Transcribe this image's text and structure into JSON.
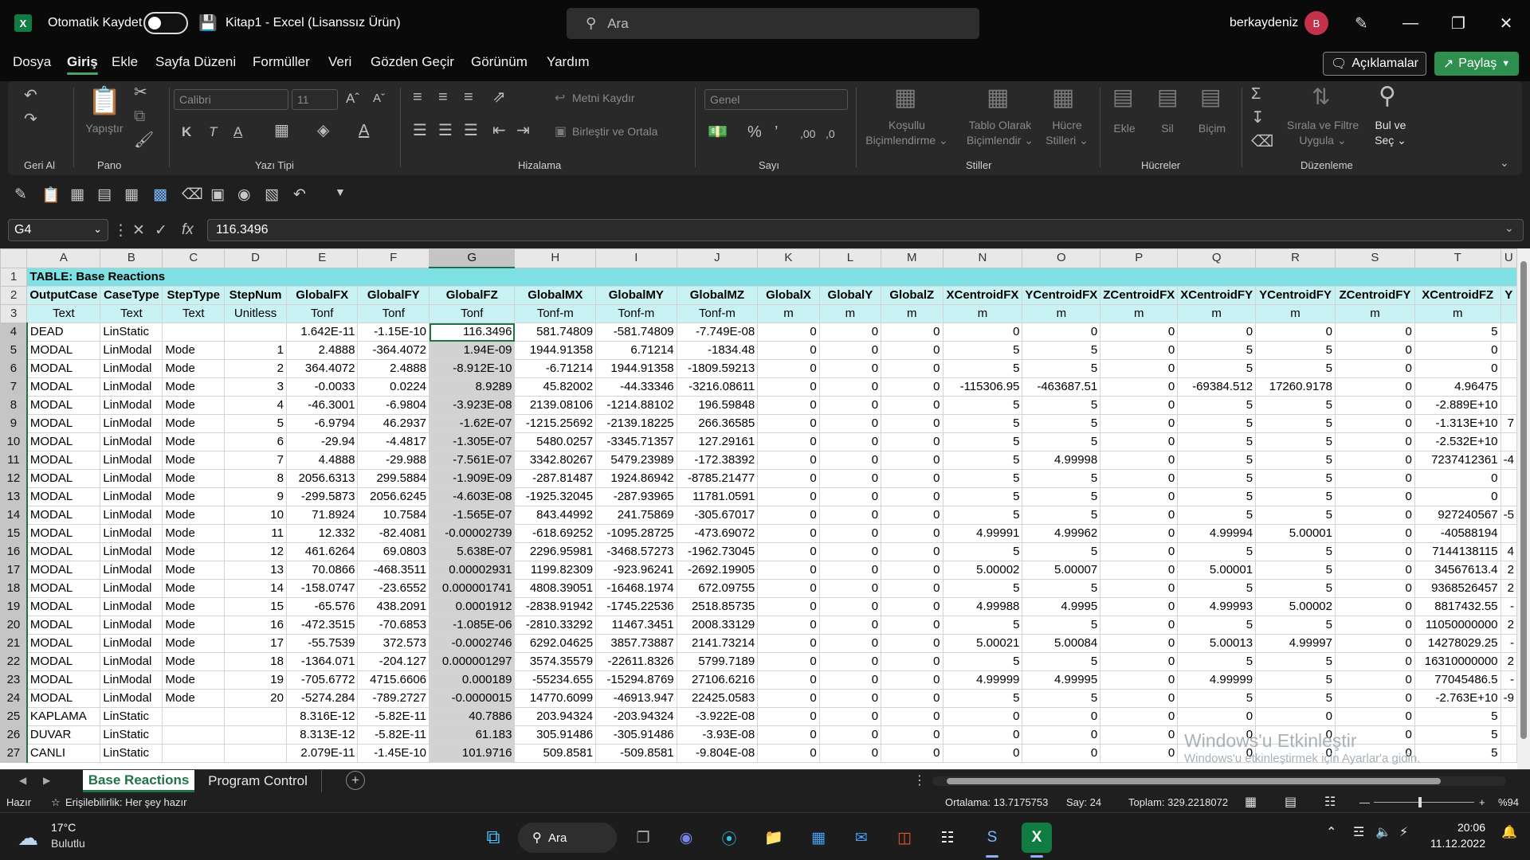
{
  "titlebar": {
    "autosave_label": "Otomatik Kaydet",
    "doc_title": "Kitap1  -  Excel (Lisanssız Ürün)",
    "search_placeholder": "Ara",
    "user_name": "berkaydeniz",
    "avatar_initial": "B"
  },
  "menu": [
    "Dosya",
    "Giriş",
    "Ekle",
    "Sayfa Düzeni",
    "Formüller",
    "Veri",
    "Gözden Geçir",
    "Görünüm",
    "Yardım"
  ],
  "comments_label": "Açıklamalar",
  "share_label": "Paylaş",
  "ribbon": {
    "groups": {
      "undo": "Geri Al",
      "clipboard": "Pano",
      "font": "Yazı Tipi",
      "alignment": "Hizalama",
      "number": "Sayı",
      "styles": "Stiller",
      "cells": "Hücreler",
      "editing": "Düzenleme"
    },
    "paste": "Yapıştır",
    "font_name": "Calibri",
    "font_size": "11",
    "wrap_text": "Metni Kaydır",
    "merge_center": "Birleştir ve Ortala",
    "number_format": "Genel",
    "cond_format": [
      "Koşullu",
      "Biçimlendirme ⌄"
    ],
    "format_table": [
      "Tablo Olarak",
      "Biçimlendir ⌄"
    ],
    "cell_styles": [
      "Hücre",
      "Stilleri ⌄"
    ],
    "insert": "Ekle",
    "delete": "Sil",
    "format": "Biçim",
    "sort_filter": [
      "Sırala ve Filtre",
      "Uygula ⌄"
    ],
    "find_select": [
      "Bul ve",
      "Seç ⌄"
    ]
  },
  "formula": {
    "name_box": "G4",
    "value": "116.3496"
  },
  "sheet": {
    "columns": [
      "A",
      "B",
      "C",
      "D",
      "E",
      "F",
      "G",
      "H",
      "I",
      "J",
      "K",
      "L",
      "M",
      "N",
      "O",
      "P",
      "Q",
      "R",
      "S",
      "T",
      "U"
    ],
    "title": "TABLE:  Base Reactions",
    "headers": [
      "OutputCase",
      "CaseType",
      "StepType",
      "StepNum",
      "GlobalFX",
      "GlobalFY",
      "GlobalFZ",
      "GlobalMX",
      "GlobalMY",
      "GlobalMZ",
      "GlobalX",
      "GlobalY",
      "GlobalZ",
      "XCentroidFX",
      "YCentroidFX",
      "ZCentroidFX",
      "XCentroidFY",
      "YCentroidFY",
      "ZCentroidFY",
      "XCentroidFZ",
      "Y"
    ],
    "units": [
      "Text",
      "Text",
      "Text",
      "Unitless",
      "Tonf",
      "Tonf",
      "Tonf",
      "Tonf-m",
      "Tonf-m",
      "Tonf-m",
      "m",
      "m",
      "m",
      "m",
      "m",
      "m",
      "m",
      "m",
      "m",
      "m",
      ""
    ],
    "rows": [
      [
        "DEAD",
        "LinStatic",
        "",
        "",
        "1.642E-11",
        "-1.15E-10",
        "116.3496",
        "581.74809",
        "-581.74809",
        "-7.749E-08",
        "0",
        "0",
        "0",
        "0",
        "0",
        "0",
        "0",
        "0",
        "0",
        "5",
        ""
      ],
      [
        "MODAL",
        "LinModal",
        "Mode",
        "1",
        "2.4888",
        "-364.4072",
        "1.94E-09",
        "1944.91358",
        "6.71214",
        "-1834.48",
        "0",
        "0",
        "0",
        "5",
        "5",
        "0",
        "5",
        "5",
        "0",
        "0",
        ""
      ],
      [
        "MODAL",
        "LinModal",
        "Mode",
        "2",
        "364.4072",
        "2.4888",
        "-8.912E-10",
        "-6.71214",
        "1944.91358",
        "-1809.59213",
        "0",
        "0",
        "0",
        "5",
        "5",
        "0",
        "5",
        "5",
        "0",
        "0",
        ""
      ],
      [
        "MODAL",
        "LinModal",
        "Mode",
        "3",
        "-0.0033",
        "0.0224",
        "8.9289",
        "45.82002",
        "-44.33346",
        "-3216.08611",
        "0",
        "0",
        "0",
        "-115306.95",
        "-463687.51",
        "0",
        "-69384.512",
        "17260.9178",
        "0",
        "4.96475",
        ""
      ],
      [
        "MODAL",
        "LinModal",
        "Mode",
        "4",
        "-46.3001",
        "-6.9804",
        "-3.923E-08",
        "2139.08106",
        "-1214.88102",
        "196.59848",
        "0",
        "0",
        "0",
        "5",
        "5",
        "0",
        "5",
        "5",
        "0",
        "-2.889E+10",
        ""
      ],
      [
        "MODAL",
        "LinModal",
        "Mode",
        "5",
        "-6.9794",
        "46.2937",
        "-1.62E-07",
        "-1215.25692",
        "-2139.18225",
        "266.36585",
        "0",
        "0",
        "0",
        "5",
        "5",
        "0",
        "5",
        "5",
        "0",
        "-1.313E+10",
        "7"
      ],
      [
        "MODAL",
        "LinModal",
        "Mode",
        "6",
        "-29.94",
        "-4.4817",
        "-1.305E-07",
        "5480.0257",
        "-3345.71357",
        "127.29161",
        "0",
        "0",
        "0",
        "5",
        "5",
        "0",
        "5",
        "5",
        "0",
        "-2.532E+10",
        ""
      ],
      [
        "MODAL",
        "LinModal",
        "Mode",
        "7",
        "4.4888",
        "-29.988",
        "-7.561E-07",
        "3342.80267",
        "5479.23989",
        "-172.38392",
        "0",
        "0",
        "0",
        "5",
        "4.99998",
        "0",
        "5",
        "5",
        "0",
        "7237412361",
        "-4"
      ],
      [
        "MODAL",
        "LinModal",
        "Mode",
        "8",
        "2056.6313",
        "299.5884",
        "-1.909E-09",
        "-287.81487",
        "1924.86942",
        "-8785.21477",
        "0",
        "0",
        "0",
        "5",
        "5",
        "0",
        "5",
        "5",
        "0",
        "0",
        ""
      ],
      [
        "MODAL",
        "LinModal",
        "Mode",
        "9",
        "-299.5873",
        "2056.6245",
        "-4.603E-08",
        "-1925.32045",
        "-287.93965",
        "11781.0591",
        "0",
        "0",
        "0",
        "5",
        "5",
        "0",
        "5",
        "5",
        "0",
        "0",
        ""
      ],
      [
        "MODAL",
        "LinModal",
        "Mode",
        "10",
        "71.8924",
        "10.7584",
        "-1.565E-07",
        "843.44992",
        "241.75869",
        "-305.67017",
        "0",
        "0",
        "0",
        "5",
        "5",
        "0",
        "5",
        "5",
        "0",
        "927240567",
        "-5"
      ],
      [
        "MODAL",
        "LinModal",
        "Mode",
        "11",
        "12.332",
        "-82.4081",
        "-0.00002739",
        "-618.69252",
        "-1095.28725",
        "-473.69072",
        "0",
        "0",
        "0",
        "4.99991",
        "4.99962",
        "0",
        "4.99994",
        "5.00001",
        "0",
        "-40588194",
        ""
      ],
      [
        "MODAL",
        "LinModal",
        "Mode",
        "12",
        "461.6264",
        "69.0803",
        "5.638E-07",
        "2296.95981",
        "-3468.57273",
        "-1962.73045",
        "0",
        "0",
        "0",
        "5",
        "5",
        "0",
        "5",
        "5",
        "0",
        "7144138115",
        "4"
      ],
      [
        "MODAL",
        "LinModal",
        "Mode",
        "13",
        "70.0866",
        "-468.3511",
        "0.00002931",
        "1199.82309",
        "-923.96241",
        "-2692.19905",
        "0",
        "0",
        "0",
        "5.00002",
        "5.00007",
        "0",
        "5.00001",
        "5",
        "0",
        "34567613.4",
        "2"
      ],
      [
        "MODAL",
        "LinModal",
        "Mode",
        "14",
        "-158.0747",
        "-23.6552",
        "0.000001741",
        "4808.39051",
        "-16468.1974",
        "672.09755",
        "0",
        "0",
        "0",
        "5",
        "5",
        "0",
        "5",
        "5",
        "0",
        "9368526457",
        "2"
      ],
      [
        "MODAL",
        "LinModal",
        "Mode",
        "15",
        "-65.576",
        "438.2091",
        "0.0001912",
        "-2838.91942",
        "-1745.22536",
        "2518.85735",
        "0",
        "0",
        "0",
        "4.99988",
        "4.9995",
        "0",
        "4.99993",
        "5.00002",
        "0",
        "8817432.55",
        "-"
      ],
      [
        "MODAL",
        "LinModal",
        "Mode",
        "16",
        "-472.3515",
        "-70.6853",
        "-1.085E-06",
        "-2810.33292",
        "11467.3451",
        "2008.33129",
        "0",
        "0",
        "0",
        "5",
        "5",
        "0",
        "5",
        "5",
        "0",
        "11050000000",
        "2"
      ],
      [
        "MODAL",
        "LinModal",
        "Mode",
        "17",
        "-55.7539",
        "372.573",
        "-0.0002746",
        "6292.04625",
        "3857.73887",
        "2141.73214",
        "0",
        "0",
        "0",
        "5.00021",
        "5.00084",
        "0",
        "5.00013",
        "4.99997",
        "0",
        "14278029.25",
        "-"
      ],
      [
        "MODAL",
        "LinModal",
        "Mode",
        "18",
        "-1364.071",
        "-204.127",
        "0.000001297",
        "3574.35579",
        "-22611.8326",
        "5799.7189",
        "0",
        "0",
        "0",
        "5",
        "5",
        "0",
        "5",
        "5",
        "0",
        "16310000000",
        "2"
      ],
      [
        "MODAL",
        "LinModal",
        "Mode",
        "19",
        "-705.6772",
        "4715.6606",
        "0.000189",
        "-55234.655",
        "-15294.8769",
        "27106.6216",
        "0",
        "0",
        "0",
        "4.99999",
        "4.99995",
        "0",
        "4.99999",
        "5",
        "0",
        "77045486.5",
        "-"
      ],
      [
        "MODAL",
        "LinModal",
        "Mode",
        "20",
        "-5274.284",
        "-789.2727",
        "-0.0000015",
        "14770.6099",
        "-46913.947",
        "22425.0583",
        "0",
        "0",
        "0",
        "5",
        "5",
        "0",
        "5",
        "5",
        "0",
        "-2.763E+10",
        "-9"
      ],
      [
        "KAPLAMA",
        "LinStatic",
        "",
        "",
        "8.316E-12",
        "-5.82E-11",
        "40.7886",
        "203.94324",
        "-203.94324",
        "-3.922E-08",
        "0",
        "0",
        "0",
        "0",
        "0",
        "0",
        "0",
        "0",
        "0",
        "5",
        ""
      ],
      [
        "DUVAR",
        "LinStatic",
        "",
        "",
        "8.313E-12",
        "-5.82E-11",
        "61.183",
        "305.91486",
        "-305.91486",
        "-3.93E-08",
        "0",
        "0",
        "0",
        "0",
        "0",
        "0",
        "0",
        "0",
        "0",
        "5",
        ""
      ],
      [
        "CANLI",
        "LinStatic",
        "",
        "",
        "2.079E-11",
        "-1.45E-10",
        "101.9716",
        "509.8581",
        "-509.8581",
        "-9.804E-08",
        "0",
        "0",
        "0",
        "0",
        "0",
        "0",
        "0",
        "0",
        "0",
        "5",
        ""
      ]
    ]
  },
  "tabs": [
    "Base Reactions",
    "Program Control"
  ],
  "watermark": {
    "line1": "Windows'u Etkinleştir",
    "line2": "Windows'u etkinleştirmek için Ayarlar'a gidin."
  },
  "status": {
    "ready": "Hazır",
    "accessibility": "Erişilebilirlik: Her şey hazır",
    "average": "Ortalama: 13.7175753",
    "count": "Say: 24",
    "sum": "Toplam: 329.2218072",
    "zoom": "%94"
  },
  "taskbar": {
    "temp": "17°C",
    "weather": "Bulutlu",
    "search": "Ara",
    "time": "20:06",
    "date": "11.12.2022"
  },
  "colors": {
    "accent": "#217346",
    "header_band": "#7fe1e4",
    "header_fill": "#c8f2f4",
    "share_button": "#2f8f4e",
    "avatar": "#c4314b"
  }
}
